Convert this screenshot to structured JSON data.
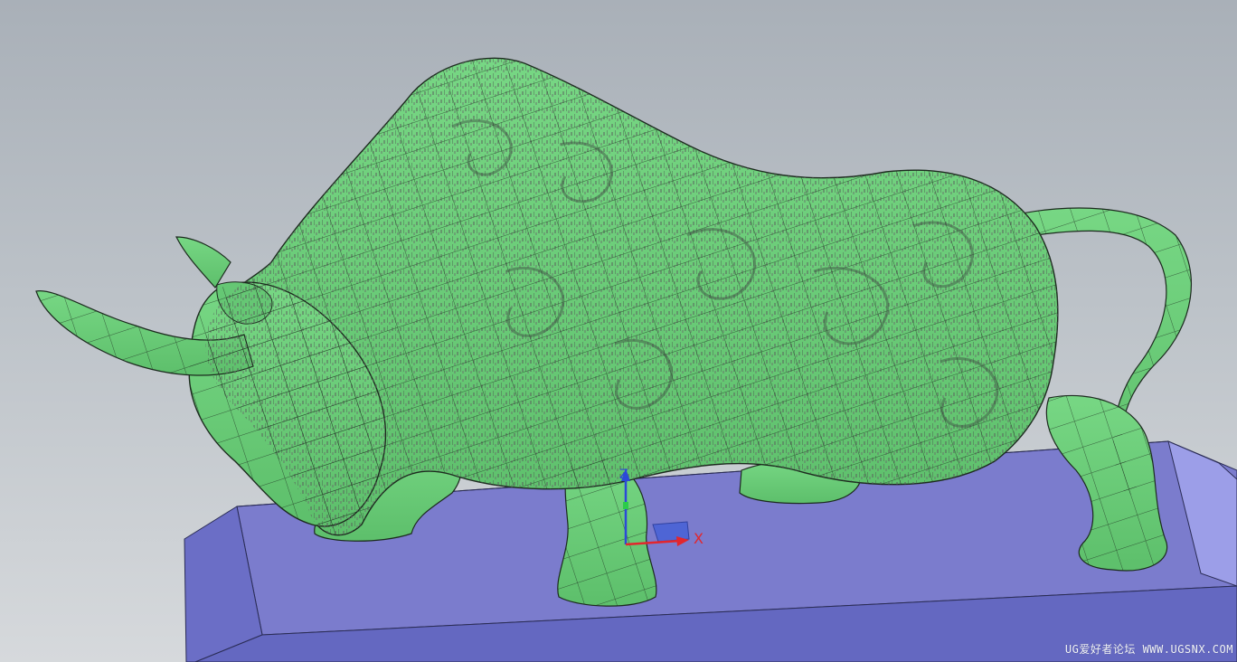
{
  "viewport": {
    "background_top": "#a9b0b8",
    "background_bottom": "#d6d9dc"
  },
  "model": {
    "name_icon": "bull-sculpture-model",
    "surface_color": "#6fcf7a",
    "mesh_color": "#1c2a1e",
    "base_top_color": "#7a7ccc",
    "base_side_color": "#6a6dc4"
  },
  "triad": {
    "x_label": "X",
    "z_label": "Z",
    "x_color": "#e3262d",
    "z_color": "#2b49d8"
  },
  "watermark": {
    "text": "UG爱好者论坛 WWW.UGSNX.COM"
  }
}
